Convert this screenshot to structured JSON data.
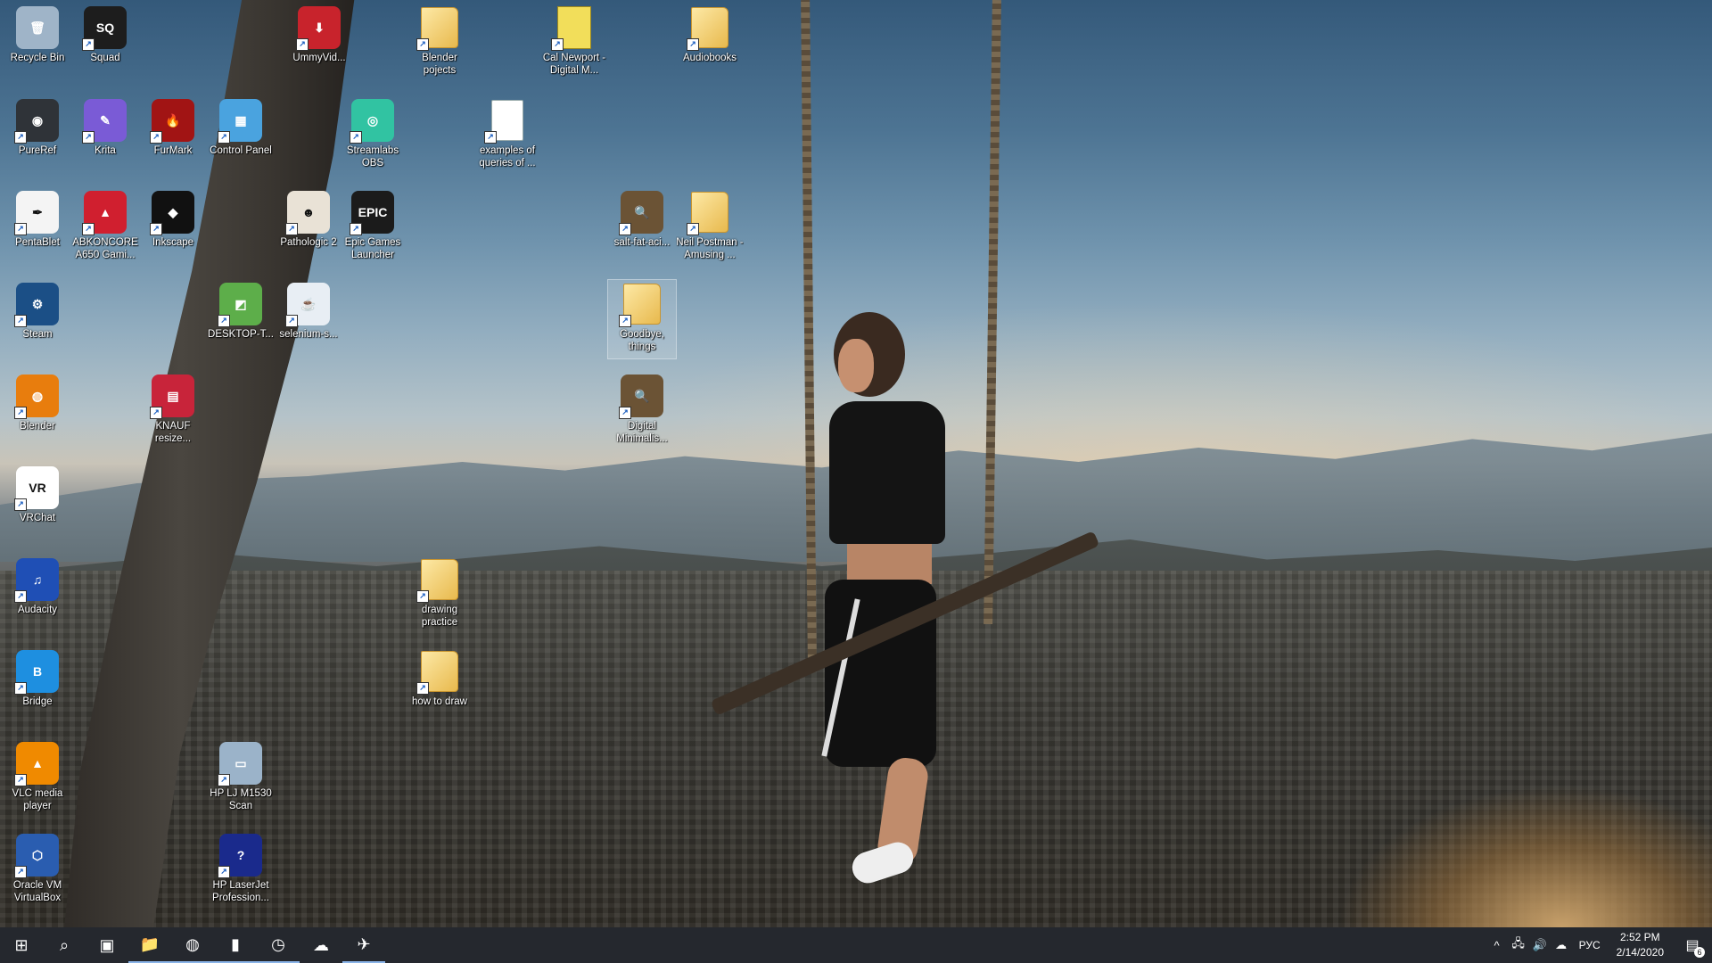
{
  "desktop": {
    "icons": [
      {
        "label": "Recycle Bin",
        "glyph": "🗑",
        "icon": "recycle-bin-icon",
        "color": "#9fb4c8"
      },
      {
        "label": "Squad",
        "glyph": "SQ",
        "icon": "squad-icon",
        "color": "#1d1d1d"
      },
      {
        "label": "UmmyVid...",
        "glyph": "⬇",
        "icon": "ummy-video-icon",
        "color": "#c8232c"
      },
      {
        "label": "Blender pojects",
        "glyph": "",
        "icon": "folder-icon",
        "color": "#e8b94d"
      },
      {
        "label": "Cal Newport - Digital M...",
        "glyph": "",
        "icon": "book-cover-icon",
        "color": "#f2de5a"
      },
      {
        "label": "Audiobooks",
        "glyph": "",
        "icon": "folder-icon",
        "color": "#e8b94d"
      },
      {
        "label": "PureRef",
        "glyph": "◉",
        "icon": "pureref-icon",
        "color": "#2f3338"
      },
      {
        "label": "Krita",
        "glyph": "✎",
        "icon": "krita-icon",
        "color": "#7a5bd6"
      },
      {
        "label": "FurMark",
        "glyph": "🔥",
        "icon": "furmark-icon",
        "color": "#a11414"
      },
      {
        "label": "Control Panel",
        "glyph": "▦",
        "icon": "control-panel-icon",
        "color": "#4aa3df"
      },
      {
        "label": "Streamlabs OBS",
        "glyph": "◎",
        "icon": "streamlabs-obs-icon",
        "color": "#31c3a2"
      },
      {
        "label": "examples of queries of ...",
        "glyph": "",
        "icon": "document-icon",
        "color": "#ffffff"
      },
      {
        "label": "PentaBlet",
        "glyph": "✒",
        "icon": "pentablet-icon",
        "color": "#f4f4f4"
      },
      {
        "label": "ABKONCORE A650 Gami...",
        "glyph": "▲",
        "icon": "abkoncore-icon",
        "color": "#d01f2f"
      },
      {
        "label": "Inkscape",
        "glyph": "◆",
        "icon": "inkscape-icon",
        "color": "#111111"
      },
      {
        "label": "Pathologic 2",
        "glyph": "☻",
        "icon": "pathologic-icon",
        "color": "#e9e2d6"
      },
      {
        "label": "Epic Games Launcher",
        "glyph": "EPIC",
        "icon": "epic-games-icon",
        "color": "#1b1b1b"
      },
      {
        "label": "salt-fat-aci...",
        "glyph": "🔍",
        "icon": "archive-search-icon",
        "color": "#6b5335"
      },
      {
        "label": "Neil Postman - Amusing ...",
        "glyph": "",
        "icon": "folder-icon",
        "color": "#e8b94d"
      },
      {
        "label": "Steam",
        "glyph": "⚙",
        "icon": "steam-icon",
        "color": "#1b4f86"
      },
      {
        "label": "DESKTOP-T...",
        "glyph": "◩",
        "icon": "remote-desktop-icon",
        "color": "#5dae4a"
      },
      {
        "label": "selenium-s...",
        "glyph": "☕",
        "icon": "java-icon",
        "color": "#e8eef4"
      },
      {
        "label": "Goodbye, things",
        "glyph": "",
        "icon": "folder-icon",
        "color": "#e8b94d"
      },
      {
        "label": "Blender",
        "glyph": "◍",
        "icon": "blender-icon",
        "color": "#e87d0d"
      },
      {
        "label": "KNAUF resize...",
        "glyph": "▤",
        "icon": "archive-icon",
        "color": "#c8243a"
      },
      {
        "label": "Digital Minimalis...",
        "glyph": "🔍",
        "icon": "archive-search-icon",
        "color": "#6b5335"
      },
      {
        "label": "VRChat",
        "glyph": "VR",
        "icon": "vrchat-icon",
        "color": "#ffffff"
      },
      {
        "label": "Audacity",
        "glyph": "♫",
        "icon": "audacity-icon",
        "color": "#1f4fb5"
      },
      {
        "label": "drawing practice",
        "glyph": "",
        "icon": "folder-icon",
        "color": "#e8b94d"
      },
      {
        "label": "Bridge",
        "glyph": "B",
        "icon": "bridge-icon",
        "color": "#1e8fe0"
      },
      {
        "label": "how to draw",
        "glyph": "",
        "icon": "folder-icon",
        "color": "#e8b94d"
      },
      {
        "label": "VLC media player",
        "glyph": "▲",
        "icon": "vlc-icon",
        "color": "#f08a00"
      },
      {
        "label": "HP LJ M1530 Scan",
        "glyph": "▭",
        "icon": "scanner-icon",
        "color": "#9bb3c9"
      },
      {
        "label": "Oracle VM VirtualBox",
        "glyph": "⬡",
        "icon": "virtualbox-icon",
        "color": "#2a5db0"
      },
      {
        "label": "HP LaserJet Profession...",
        "glyph": "?",
        "icon": "hp-help-icon",
        "color": "#1a2a8c"
      }
    ]
  },
  "taskbar": {
    "start_glyph": "⊞",
    "search_glyph": "⌕",
    "taskview_glyph": "▣",
    "apps": [
      {
        "name": "file-explorer",
        "glyph": "📁",
        "running": true
      },
      {
        "name": "chrome",
        "glyph": "◍",
        "running": true
      },
      {
        "name": "book-reader",
        "glyph": "▮",
        "running": true
      },
      {
        "name": "clock-app",
        "glyph": "◷",
        "running": true
      },
      {
        "name": "onedrive-app",
        "glyph": "☁",
        "running": false
      },
      {
        "name": "telegram",
        "glyph": "✈",
        "running": true
      }
    ],
    "tray": {
      "chevron": "^",
      "network": "🖧",
      "volume": "🔊",
      "cloud": "☁",
      "language": "РУС",
      "time": "2:52 PM",
      "date": "2/14/2020",
      "notifications_count": "6"
    }
  }
}
